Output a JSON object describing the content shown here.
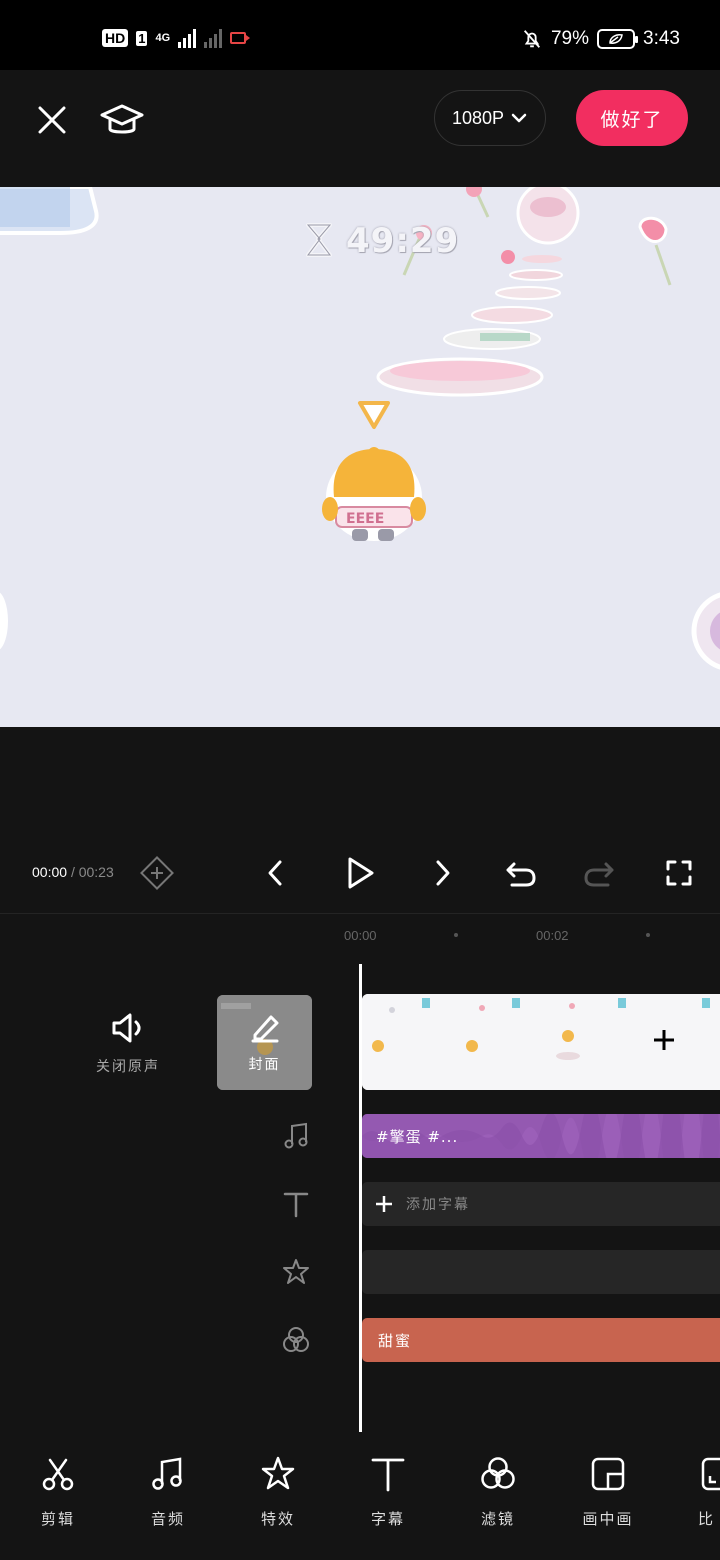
{
  "status_bar": {
    "hd": "HD",
    "sim": "1",
    "network": "4G",
    "battery_percent": "79%",
    "time": "3:43"
  },
  "top_bar": {
    "resolution": "1080P",
    "done_label": "做好了"
  },
  "preview": {
    "timer": "49:29"
  },
  "playback": {
    "current": "00:00",
    "separator": "/",
    "total": "00:23"
  },
  "ruler": {
    "ticks": [
      "00:00",
      "00:02"
    ]
  },
  "timeline": {
    "mute_label": "关闭原声",
    "cover_label": "封面",
    "audio_clip_label": "#擎蛋 #...",
    "caption_placeholder": "添加字幕",
    "filter_clip_label": "甜蜜"
  },
  "toolbar": {
    "items": [
      {
        "label": "剪辑",
        "icon": "scissors-icon"
      },
      {
        "label": "音频",
        "icon": "music-note-icon"
      },
      {
        "label": "特效",
        "icon": "star-effect-icon"
      },
      {
        "label": "字幕",
        "icon": "text-icon"
      },
      {
        "label": "滤镜",
        "icon": "filter-circles-icon"
      },
      {
        "label": "画中画",
        "icon": "picture-in-picture-icon"
      },
      {
        "label": "比",
        "icon": "ratio-icon"
      }
    ]
  },
  "colors": {
    "accent": "#f22e60",
    "audio_track": "#9b5fb8",
    "filter_track": "#c8644f",
    "background": "#141414"
  }
}
